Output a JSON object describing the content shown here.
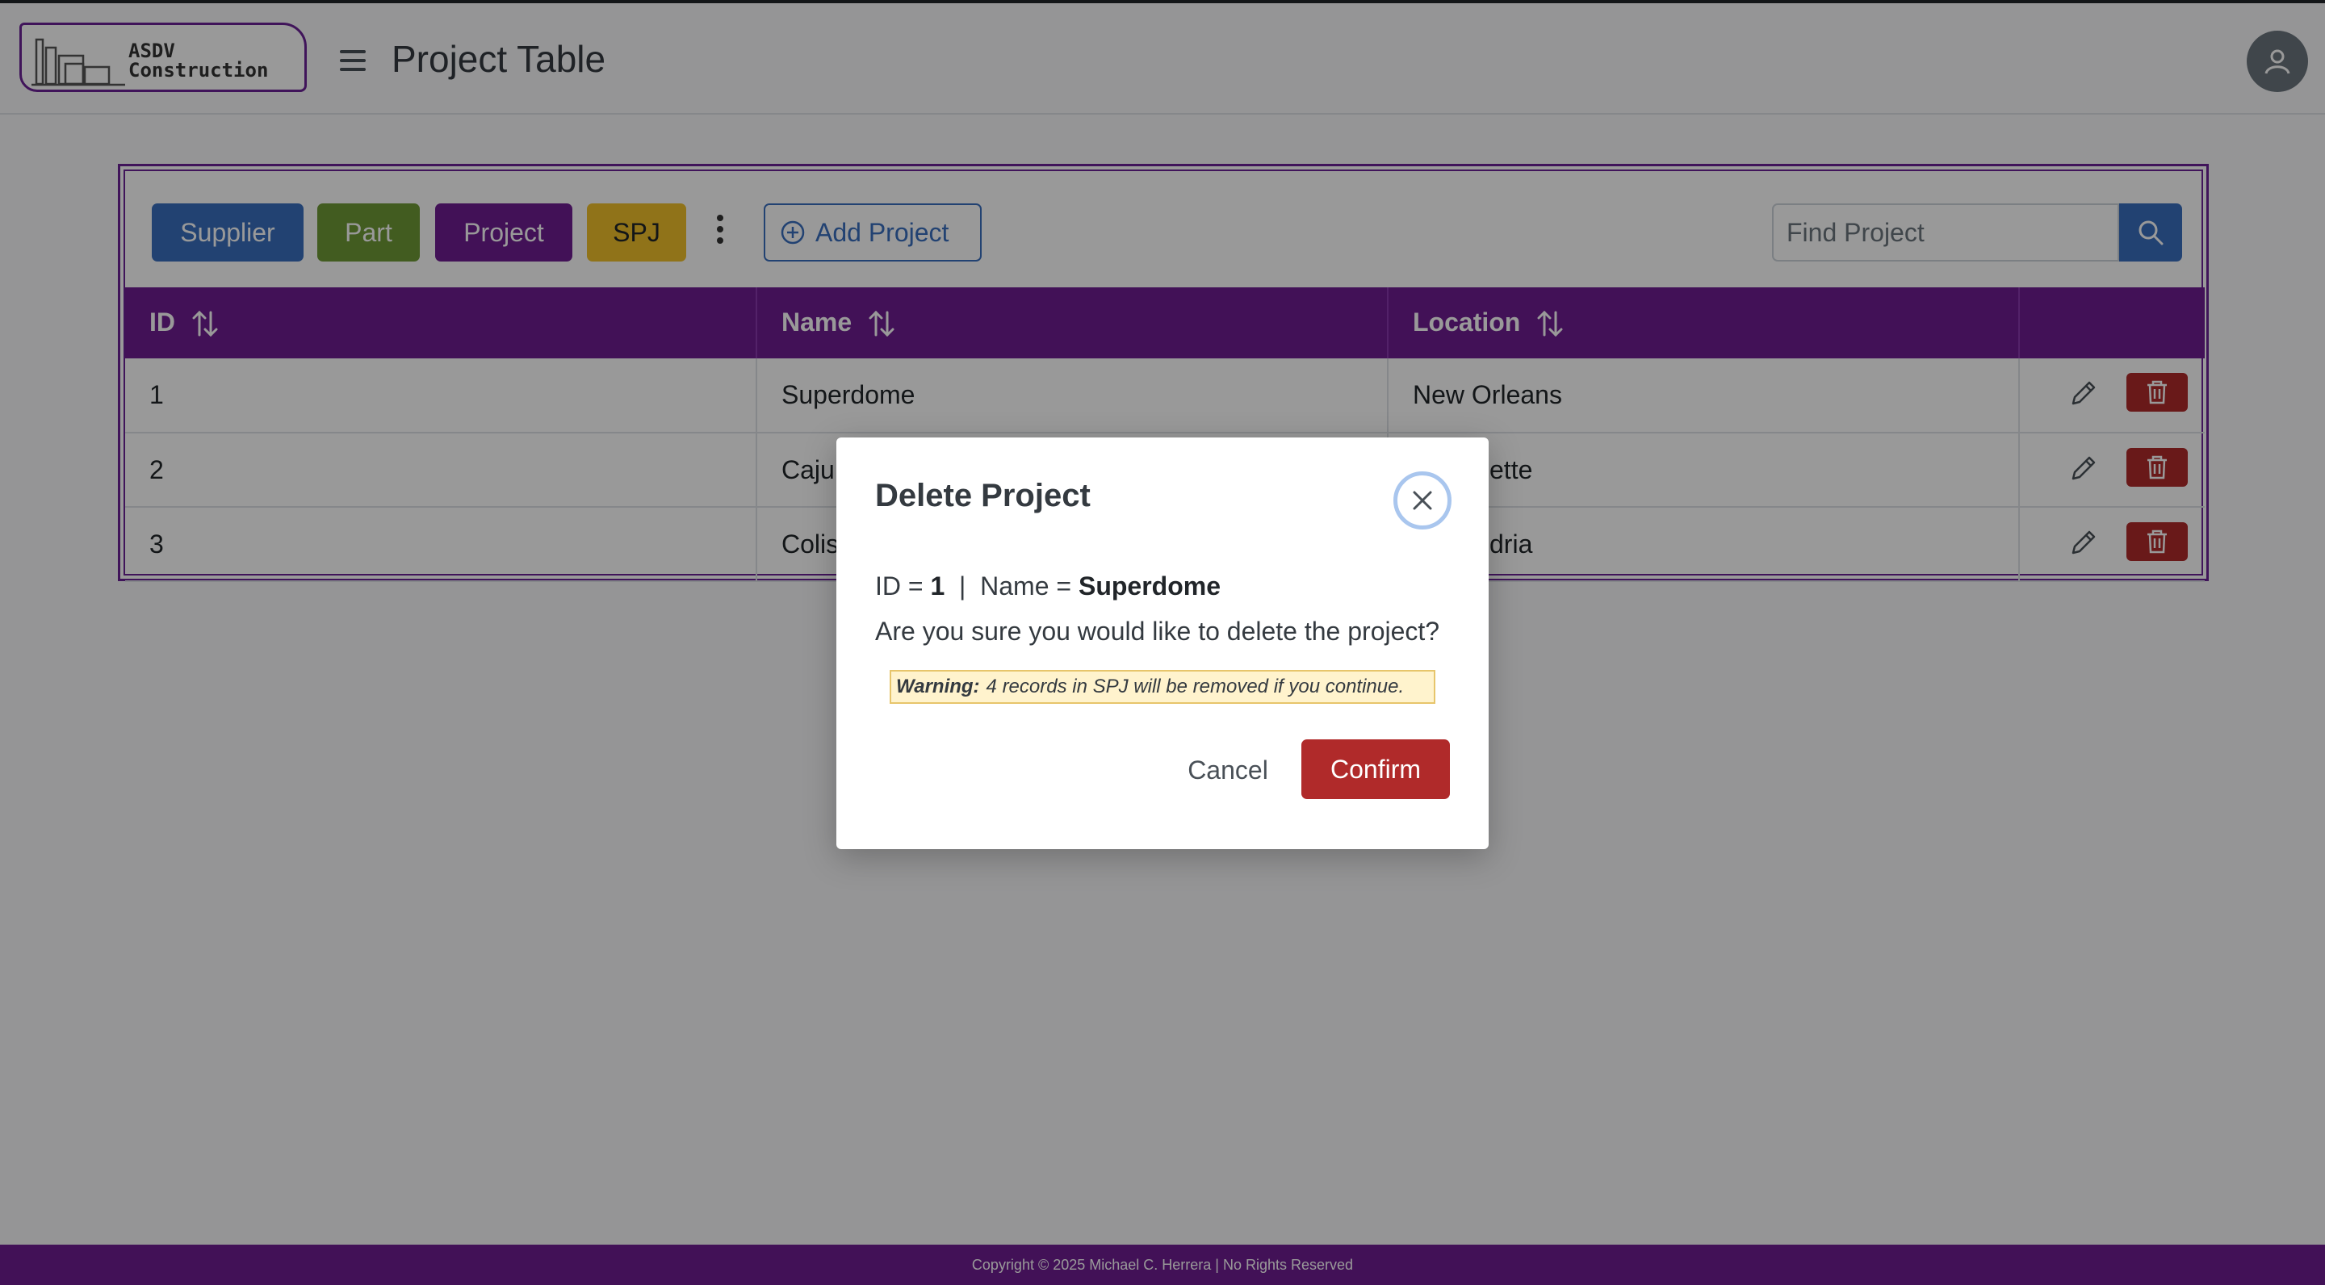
{
  "header": {
    "logo_line1": "ASDV",
    "logo_line2": "Construction",
    "page_title": "Project Table"
  },
  "toolbar": {
    "tabs": [
      "Supplier",
      "Part",
      "Project",
      "SPJ"
    ],
    "add_label": "Add Project",
    "search_placeholder": "Find Project"
  },
  "table": {
    "columns": [
      "ID",
      "Name",
      "Location",
      ""
    ],
    "rows": [
      {
        "id": "1",
        "name": "Superdome",
        "location": "New Orleans"
      },
      {
        "id": "2",
        "name": "Cajun",
        "location": "ette"
      },
      {
        "id": "3",
        "name": "Colis",
        "location": "dria"
      }
    ]
  },
  "modal": {
    "title": "Delete Project",
    "id_label": "ID = ",
    "id_value": "1",
    "sep": "  |  ",
    "name_label": "Name = ",
    "name_value": "Superdome",
    "question": "Are you sure you would like to delete the project?",
    "warning_label": "Warning:",
    "warning_text": "4 records in SPJ will be removed if you continue.",
    "cancel_label": "Cancel",
    "confirm_label": "Confirm"
  },
  "footer": {
    "text": "Copyright © 2025 Michael C. Herrera  |  No Rights Reserved"
  },
  "colors": {
    "brand_purple": "#6f1d92",
    "supplier_blue": "#3a6fbf",
    "part_green": "#6e9a36",
    "spj_yellow": "#f0c02a",
    "danger_red": "#b02a2a"
  },
  "icons": [
    "menu-icon",
    "user-icon",
    "kebab-icon",
    "plus-circle-icon",
    "search-icon",
    "sort-icon",
    "pencil-icon",
    "trash-icon",
    "close-icon"
  ]
}
